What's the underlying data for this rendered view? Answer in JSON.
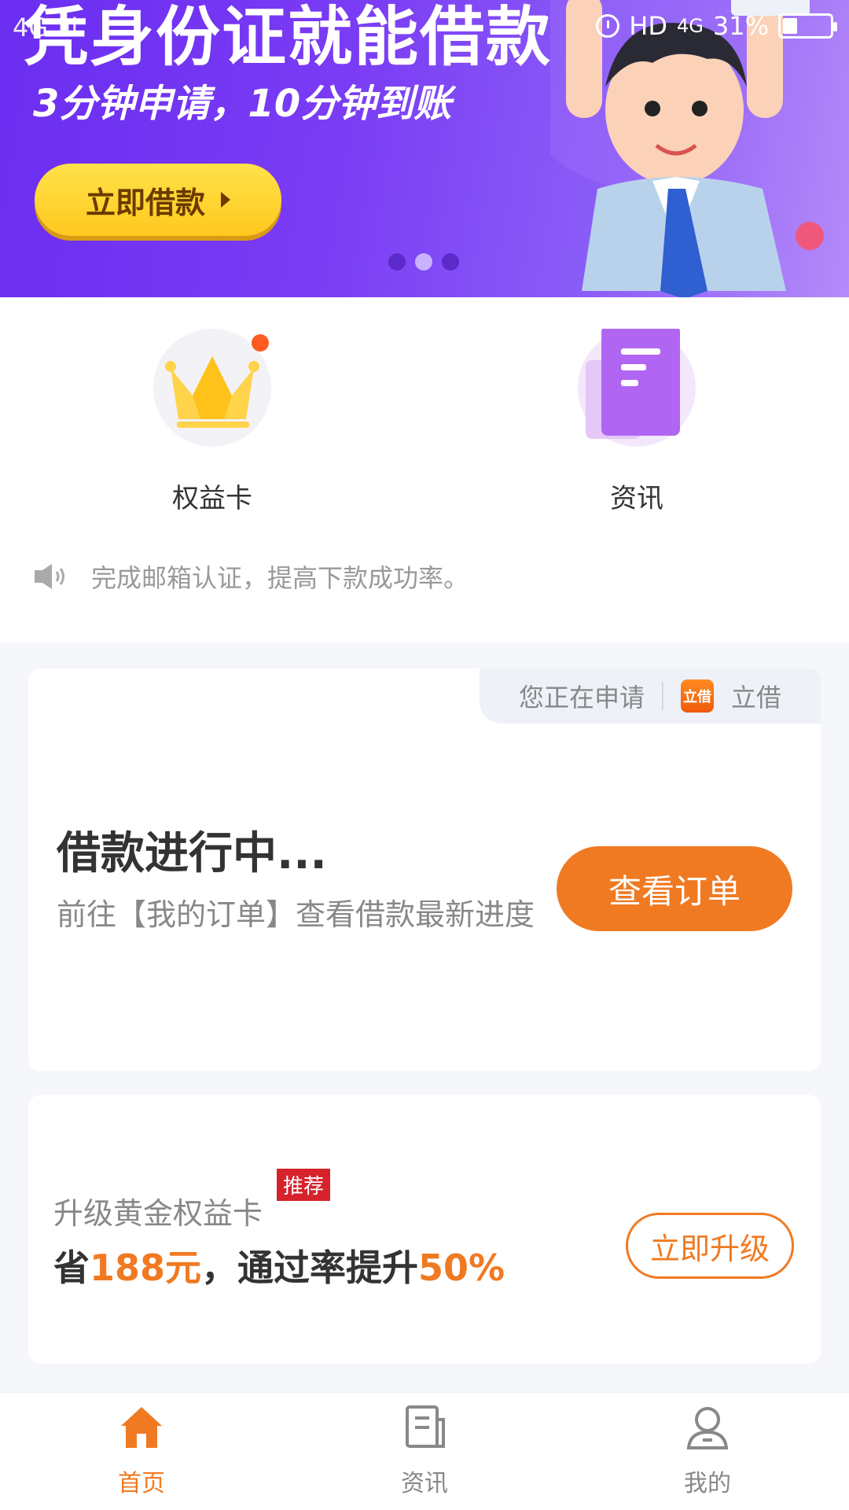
{
  "status_bar": {
    "left": "4G .ıl",
    "hd": "HD",
    "network": "4G",
    "battery": "31%",
    "battery_level": 0.31
  },
  "banner": {
    "title": "凭身份证就能借款",
    "subtitle": "3分钟申请，10分钟到账",
    "cta_label": "立即借款",
    "page_count": 3,
    "active_page": 2
  },
  "entries": [
    {
      "label": "权益卡",
      "icon": "crown-icon"
    },
    {
      "label": "资讯",
      "icon": "news-document-icon"
    }
  ],
  "notice": {
    "text": "完成邮箱认证，提高下款成功率。"
  },
  "loan_card": {
    "tag_text": "您正在申请",
    "brand_logo_text": "立借",
    "brand_name": "立借",
    "title": "借款进行中...",
    "description": "前往【我的订单】查看借款最新进度",
    "button_label": "查看订单"
  },
  "upgrade_card": {
    "title": "升级黄金权益卡",
    "badge": "推荐",
    "desc_prefix": "省",
    "desc_amount": "188元",
    "desc_middle": "，通过率提升",
    "desc_rate": "50%",
    "button_label": "立即升级"
  },
  "tabbar": {
    "tabs": [
      {
        "label": "首页",
        "icon": "home-icon",
        "active": true
      },
      {
        "label": "资讯",
        "icon": "news-icon",
        "active": false
      },
      {
        "label": "我的",
        "icon": "profile-icon",
        "active": false
      }
    ]
  },
  "colors": {
    "accent": "#f07a22",
    "banner_purple": "#6b2df0",
    "button_yellow": "#ffd02a",
    "badge_red": "#d6222b"
  }
}
